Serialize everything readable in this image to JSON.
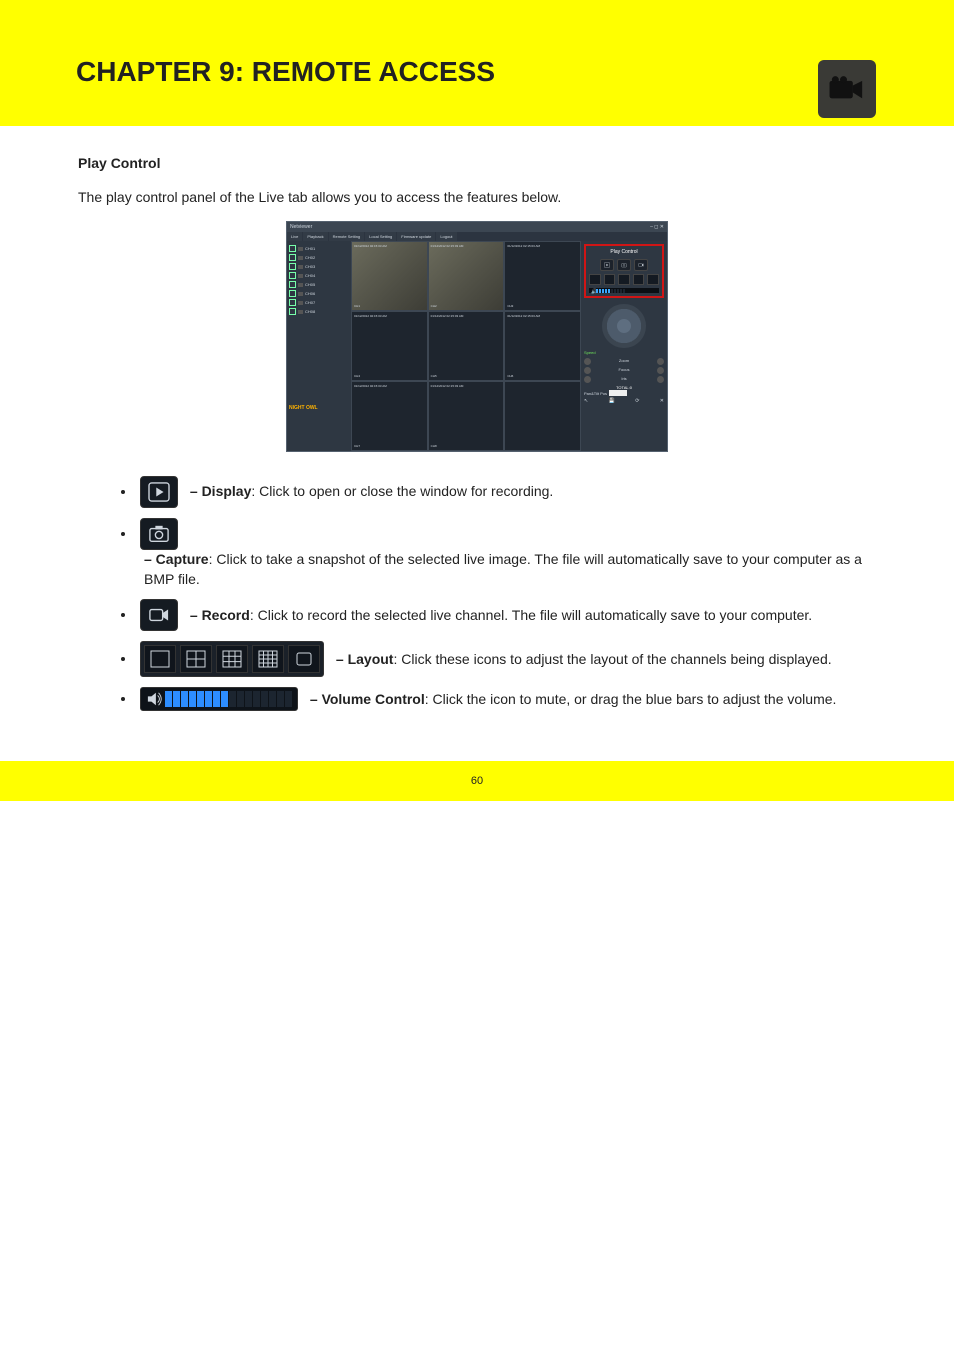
{
  "header": {
    "title": "CHAPTER 9: REMOTE ACCESS"
  },
  "intro": {
    "heading": "Play Control",
    "text": "The play control panel of the Live tab allows you to access the features below."
  },
  "app": {
    "window_title": "Netviewer",
    "tabs": [
      "Live",
      "Playback",
      "Remote Setting",
      "Local Setting",
      "Firmware update",
      "Logout"
    ],
    "channels": [
      "CH01",
      "CH02",
      "CH03",
      "CH04",
      "CH05",
      "CH06",
      "CH07",
      "CH08"
    ],
    "brand": "NIGHT OWL",
    "tile_ts": "01/12/2012 02:15:03 AM",
    "tile_labels": [
      "CH1",
      "CH2",
      "CH3",
      "CH4",
      "CH5",
      "CH6",
      "CH7",
      "CH8"
    ],
    "right": {
      "title": "Play Control",
      "speed": "Speed",
      "zoom": "Zoom",
      "focus": "Focus",
      "iris": "Iris",
      "total": "TOTAL:0",
      "pantilt": "Pan&Tilt Pos"
    }
  },
  "bullets": {
    "b1_label": "– Display",
    "b1_text": "Click to open or close the window for recording.",
    "b2_label": "– Capture",
    "b2_text": "Click to take a snapshot of the selected live image. The file will automatically save to your computer as a BMP file.",
    "b3_label": "– Record",
    "b3_text": "Click to record the selected live channel. The file will automatically save to your computer.",
    "b4_label": "– Layout",
    "b4_text": "Click these icons to adjust the layout of the channels being displayed.",
    "b5_label": "– Volume Control",
    "b5_text": "Click the icon to mute, or drag the blue bars to adjust the volume."
  },
  "footer": {
    "page": "60"
  }
}
